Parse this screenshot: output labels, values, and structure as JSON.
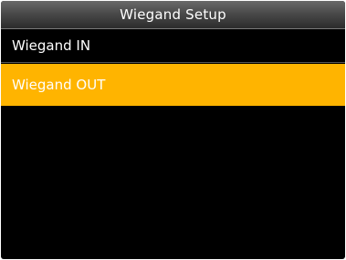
{
  "header": {
    "title": "Wiegand Setup"
  },
  "menu": {
    "items": [
      {
        "label": "Wiegand IN",
        "selected": false
      },
      {
        "label": "Wiegand OUT",
        "selected": true
      }
    ]
  },
  "colors": {
    "background": "#000000",
    "selected_highlight": "#ffb400",
    "text": "#ffffff"
  }
}
